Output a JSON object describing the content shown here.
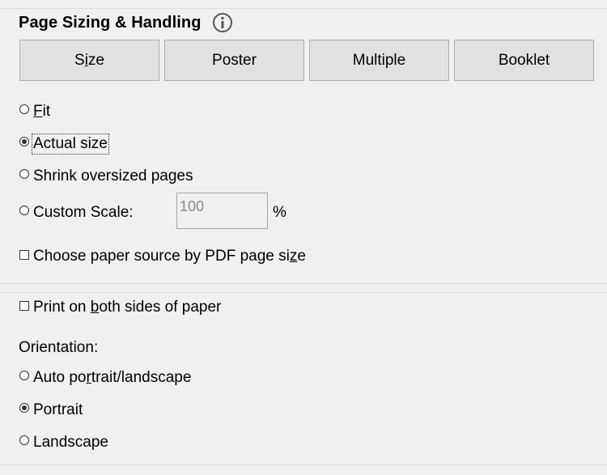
{
  "section": {
    "title": "Page Sizing & Handling",
    "info_icon": "info-icon"
  },
  "tabs": [
    {
      "label": "Size",
      "underline_index": 1
    },
    {
      "label": "Poster"
    },
    {
      "label": "Multiple"
    },
    {
      "label": "Booklet"
    }
  ],
  "sizing_options": [
    {
      "label": "Fit",
      "selected": false
    },
    {
      "label": "Actual size",
      "selected": true
    },
    {
      "label": "Shrink oversized pages",
      "selected": false
    },
    {
      "label": "Custom Scale:",
      "selected": false
    }
  ],
  "custom_scale": {
    "value": "100",
    "unit": "%"
  },
  "paper_source": {
    "label": "Choose paper source by PDF page size",
    "checked": false
  },
  "duplex": {
    "label": "Print on both sides of paper",
    "checked": false
  },
  "orientation": {
    "heading": "Orientation:",
    "options": [
      {
        "label": "Auto portrait/landscape",
        "selected": false
      },
      {
        "label": "Portrait",
        "selected": true
      },
      {
        "label": "Landscape",
        "selected": false
      }
    ]
  }
}
